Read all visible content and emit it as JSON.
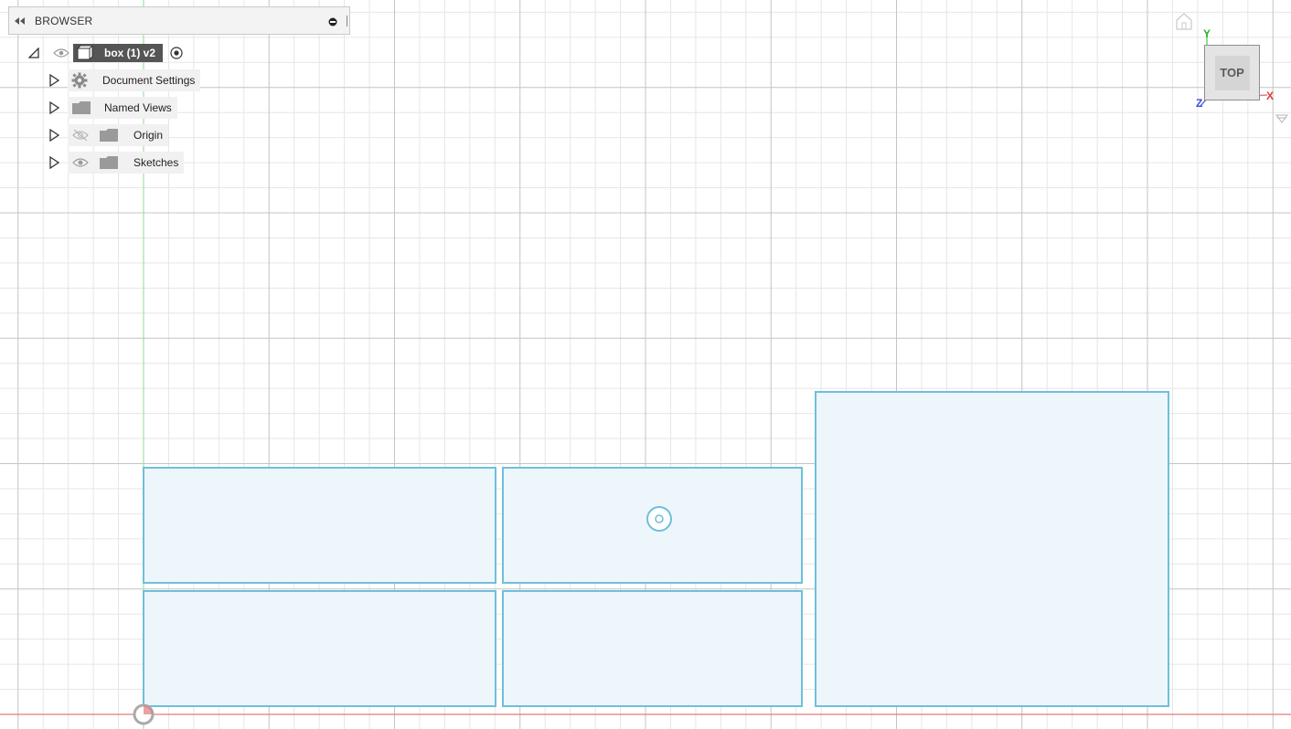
{
  "browser": {
    "title": "BROWSER",
    "root": {
      "label": "box (1) v2"
    },
    "items": [
      {
        "label": "Document Settings",
        "icon": "gear-icon"
      },
      {
        "label": "Named Views",
        "icon": "folder-icon"
      },
      {
        "label": "Origin",
        "icon": "folder-icon",
        "visibility": "hidden-eye-icon"
      },
      {
        "label": "Sketches",
        "icon": "folder-icon",
        "visibility": "eye-icon"
      }
    ]
  },
  "view_cube": {
    "face": "TOP",
    "axes": {
      "x": "X",
      "y": "Y",
      "z": "Z"
    }
  },
  "colors": {
    "grid_minor": "#e6e6e6",
    "grid_major": "#c4c4c4",
    "x_axis": "#e07a7a",
    "y_axis": "#9ee39e",
    "sketch_stroke": "#6fbfdc",
    "sketch_fill": "#edf6fb",
    "axis_x_label": "#e03c3c",
    "axis_y_label": "#2fb62f",
    "axis_z_label": "#3a4fd6"
  }
}
